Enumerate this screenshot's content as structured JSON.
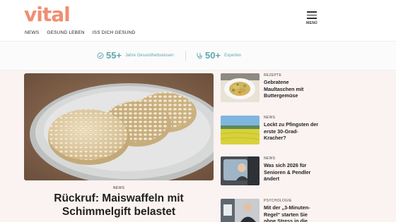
{
  "brand": {
    "logo": "vital",
    "accent_color": "#ef8e72",
    "stat_color": "#5fa7ad"
  },
  "header": {
    "menu_label": "MENÜ",
    "nav": [
      "NEWS",
      "GESUND LEBEN",
      "ISS DICH GESUND"
    ]
  },
  "stats": [
    {
      "icon": "check-badge-icon",
      "value": "55+",
      "label": "Jahre Gesundheitswissen"
    },
    {
      "icon": "stethoscope-icon",
      "value": "50+",
      "label": "Experten"
    }
  ],
  "hero": {
    "tag": "NEWS",
    "title": "Rückruf: Maiswaffeln mit Schimmelgift belastet"
  },
  "side_articles": [
    {
      "tag": "REZEPTE",
      "title": "Gebratene Maultaschen mit Buttergemüse"
    },
    {
      "tag": "NEWS",
      "title": "Lockt zu Pfingsten der erste 30-Grad-Kracher?"
    },
    {
      "tag": "NEWS",
      "title": "Was sich 2026 für Senioren & Pendler ändert"
    },
    {
      "tag": "PSYCHOLOGIE",
      "title": "Mit der „3-Minuten-Regel“ starten Sie ohne Stress in die"
    }
  ]
}
